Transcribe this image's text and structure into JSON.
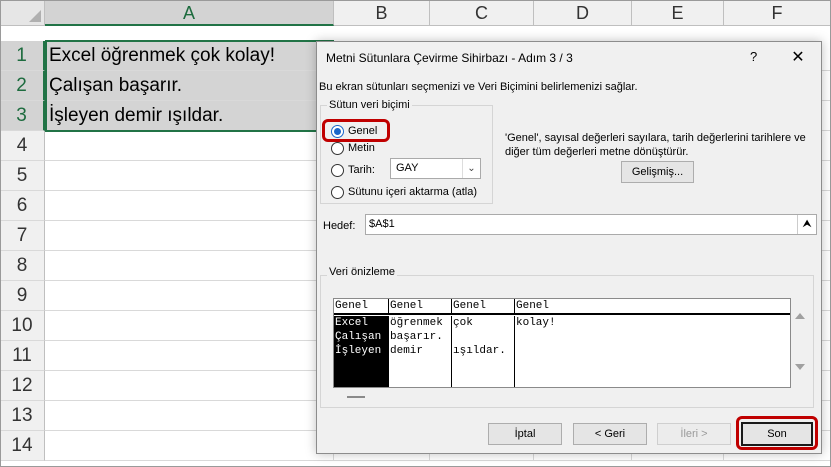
{
  "sheet": {
    "columns": [
      "A",
      "B",
      "C",
      "D",
      "E",
      "F"
    ],
    "rows": [
      "1",
      "2",
      "3",
      "4",
      "5",
      "6",
      "7",
      "8",
      "9",
      "10",
      "11",
      "12",
      "13",
      "14"
    ],
    "cells": {
      "a1": "Excel öğrenmek çok kolay!",
      "a2": "Çalışan başarır.",
      "a3": "İşleyen demir ışıldar."
    }
  },
  "dialog": {
    "title": "Metni Sütunlara Çevirme Sihirbazı - Adım 3 / 3",
    "help_label": "?",
    "close_label": "✕",
    "description": "Bu ekran sütunları seçmenizi ve Veri Biçimini belirlemenizi  sağlar.",
    "format_group": {
      "legend": "Sütun veri biçimi",
      "options": [
        "Genel",
        "Metin",
        "Tarih:",
        "Sütunu içeri aktarma (atla)"
      ],
      "selected": "Genel",
      "date_value": "GAY"
    },
    "info_text": "'Genel', sayısal değerleri sayılara, tarih değerlerini tarihlere ve diğer tüm değerleri metne dönüştürür.",
    "advanced_button": "Gelişmiş...",
    "destination_label": "Hedef:",
    "destination_value": "$A$1",
    "preview": {
      "legend": "Veri önizleme",
      "headers": [
        "Genel",
        "Genel",
        "Genel",
        "Genel"
      ],
      "columns": [
        "Excel\nÇalışan\nİşleyen",
        "öğrenmek\nbaşarır.\ndemir",
        "çok\n\nışıldar.",
        "kolay!"
      ]
    },
    "buttons": {
      "cancel": "İptal",
      "back": "< Geri",
      "next": "İleri >",
      "finish": "Son"
    }
  },
  "colors": {
    "accent_green": "#217346",
    "highlight_red": "#c00000",
    "radio_blue": "#1a66c9"
  }
}
